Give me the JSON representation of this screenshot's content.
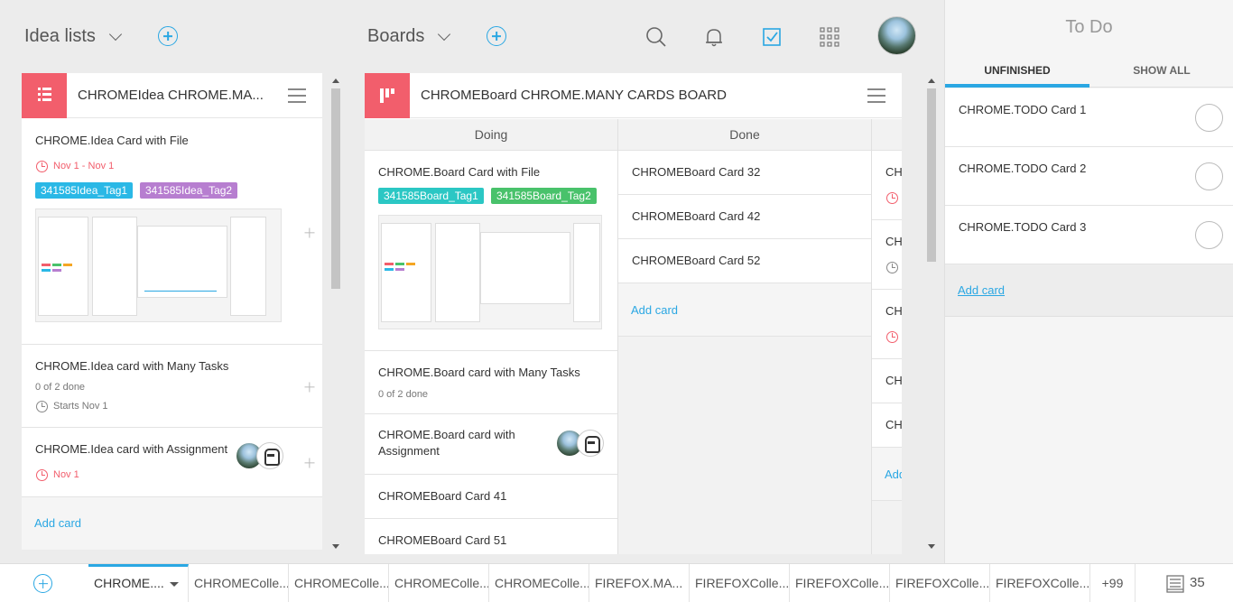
{
  "header": {
    "idea_lists_label": "Idea lists",
    "boards_label": "Boards"
  },
  "idea_panel": {
    "title": "CHROMEIdea CHROME.MA...",
    "cards": [
      {
        "title": "CHROME.Idea Card with File",
        "date": "Nov 1 - Nov 1",
        "tags": [
          "341585Idea_Tag1",
          "341585Idea_Tag2"
        ]
      },
      {
        "title": "CHROME.Idea card with Many Tasks",
        "progress": "0 of 2 done",
        "starts": "Starts Nov 1"
      },
      {
        "title": "CHROME.Idea card with Assignment",
        "date": "Nov 1"
      }
    ],
    "add_card": "Add card"
  },
  "board_panel": {
    "title": "CHROMEBoard CHROME.MANY CARDS BOARD",
    "columns": [
      {
        "name": "Doing",
        "cards": [
          {
            "title": "CHROME.Board Card with File",
            "tags": [
              "341585Board_Tag1",
              "341585Board_Tag2"
            ]
          },
          {
            "title": "CHROME.Board card with Many Tasks",
            "progress": "0 of 2 done"
          },
          {
            "title_line1": "CHROME.Board card with",
            "title_line2": "Assignment"
          },
          {
            "title": "CHROMEBoard Card 41"
          },
          {
            "title": "CHROMEBoard Card 51"
          }
        ]
      },
      {
        "name": "Done",
        "cards": [
          {
            "title": "CHROMEBoard Card 32"
          },
          {
            "title": "CHROMEBoard Card 42"
          },
          {
            "title": "CHROMEBoard Card 52"
          }
        ],
        "add_card": "Add card"
      },
      {
        "name": "",
        "cards": [
          {
            "title": "CH"
          },
          {
            "title": "CH"
          },
          {
            "title": "CH"
          },
          {
            "title": "CH"
          },
          {
            "title": "CH"
          }
        ],
        "add_card": "Add"
      }
    ]
  },
  "todo": {
    "title": "To Do",
    "tabs": [
      "UNFINISHED",
      "SHOW ALL"
    ],
    "items": [
      "CHROME.TODO Card 1",
      "CHROME.TODO Card 2",
      "CHROME.TODO Card 3"
    ],
    "add_card": "Add card"
  },
  "bottom_tabs": [
    "CHROME....",
    "CHROMEColle...",
    "CHROMEColle...",
    "CHROMEColle...",
    "CHROMEColle...",
    "FIREFOX.MA...",
    "FIREFOXColle...",
    "FIREFOXColle...",
    "FIREFOXColle...",
    "FIREFOXColle..."
  ],
  "bottom_more": "+99",
  "bottom_count": "35",
  "colors": {
    "accent": "#2aa7e3",
    "badge_red": "#f25e6c",
    "idea_tag1": "#2ab8e6",
    "idea_tag2": "#b77ed0",
    "board_tag1": "#2bc7c4",
    "board_tag2": "#49c26b"
  }
}
